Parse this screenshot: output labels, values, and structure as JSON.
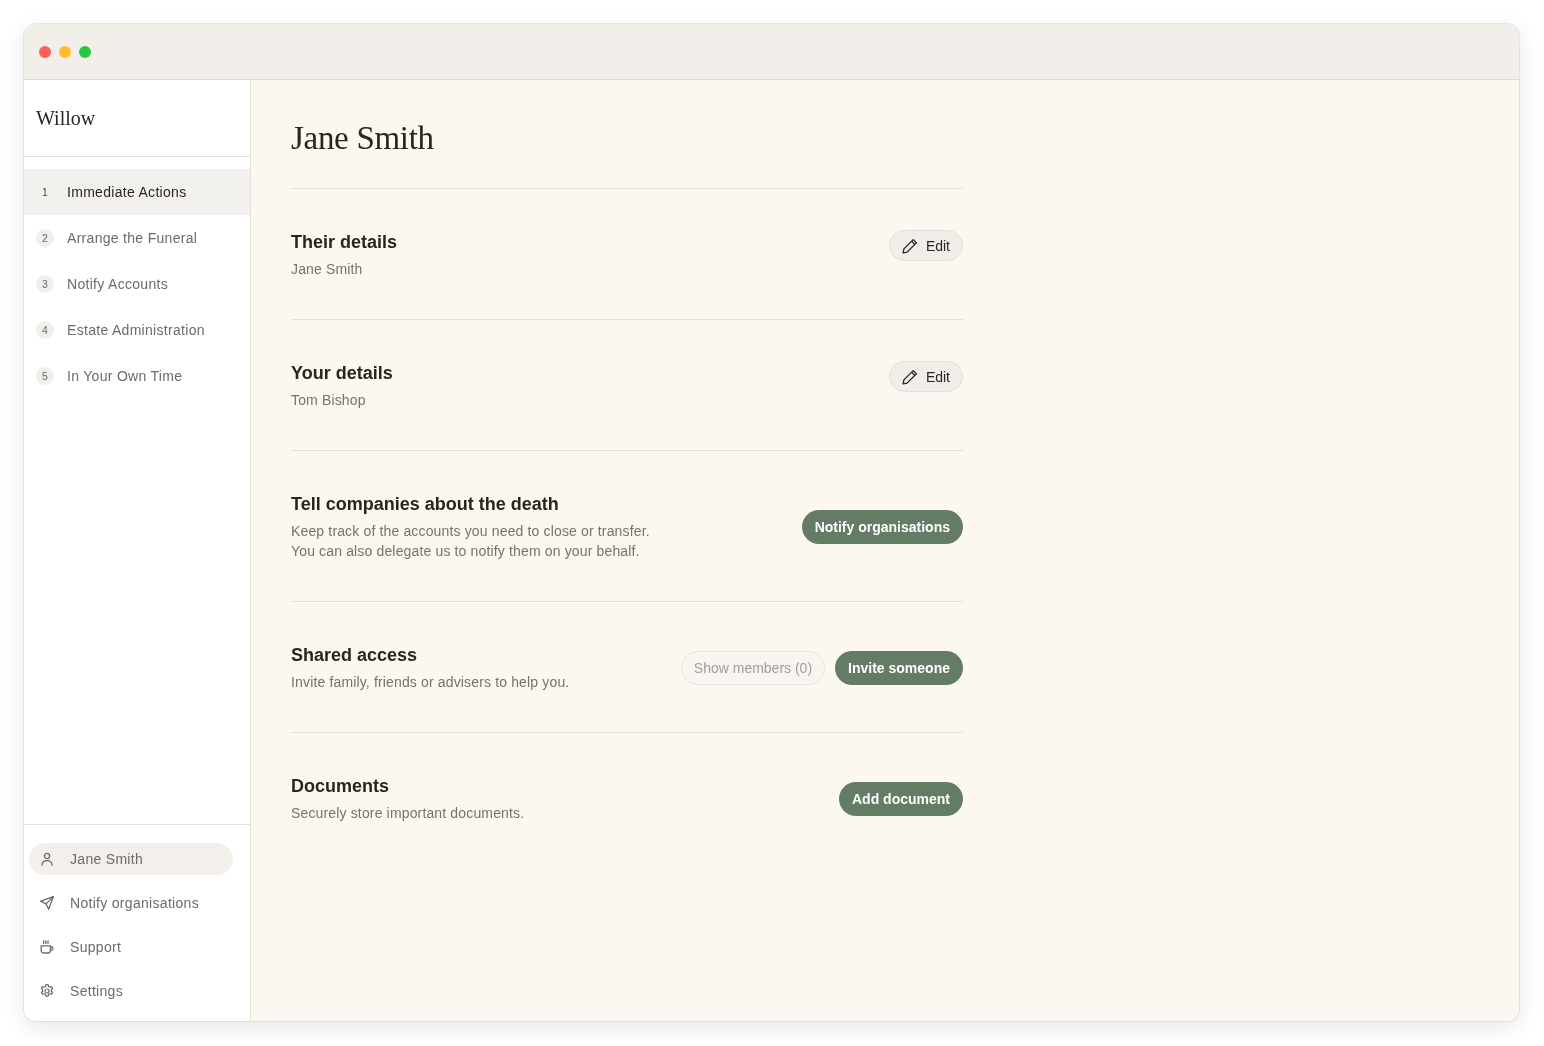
{
  "sidebar": {
    "logo": "Willow",
    "steps": [
      {
        "number": "1",
        "label": "Immediate Actions",
        "selected": true
      },
      {
        "number": "2",
        "label": "Arrange the Funeral",
        "selected": false
      },
      {
        "number": "3",
        "label": "Notify Accounts",
        "selected": false
      },
      {
        "number": "4",
        "label": "Estate Administration",
        "selected": false
      },
      {
        "number": "5",
        "label": "In Your Own Time",
        "selected": false
      }
    ],
    "footer_items": [
      {
        "kind": "profile",
        "label": "Jane Smith",
        "selected": true
      },
      {
        "kind": "notify",
        "label": "Notify organisations",
        "selected": false
      },
      {
        "kind": "support",
        "label": "Support",
        "selected": false
      },
      {
        "kind": "settings",
        "label": "Settings",
        "selected": false
      }
    ]
  },
  "main": {
    "title": "Jane Smith",
    "sections": [
      {
        "title": "Their details",
        "description_lines": [
          "Jane Smith"
        ],
        "actions": [
          {
            "kind": "edit",
            "label": "Edit",
            "disabled": false
          }
        ]
      },
      {
        "title": "Your details",
        "description_lines": [
          "Tom Bishop"
        ],
        "actions": [
          {
            "kind": "edit",
            "label": "Edit",
            "disabled": false
          }
        ]
      },
      {
        "title": "Tell companies about the death",
        "description_lines": [
          "Keep track of the accounts you need to close or transfer.",
          "You can also delegate us to notify them on your behalf."
        ],
        "actions": [
          {
            "kind": "primary",
            "label": "Notify organisations",
            "disabled": false
          }
        ]
      },
      {
        "title": "Shared access",
        "description_lines": [
          "Invite family, friends or advisers to help you."
        ],
        "actions": [
          {
            "kind": "secondary",
            "label": "Show members (0)",
            "disabled": true
          },
          {
            "kind": "primary",
            "label": "Invite someone",
            "disabled": false
          }
        ]
      },
      {
        "title": "Documents",
        "description_lines": [
          "Securely store important documents."
        ],
        "actions": [
          {
            "kind": "primary",
            "label": "Add document",
            "disabled": false
          }
        ]
      }
    ]
  }
}
